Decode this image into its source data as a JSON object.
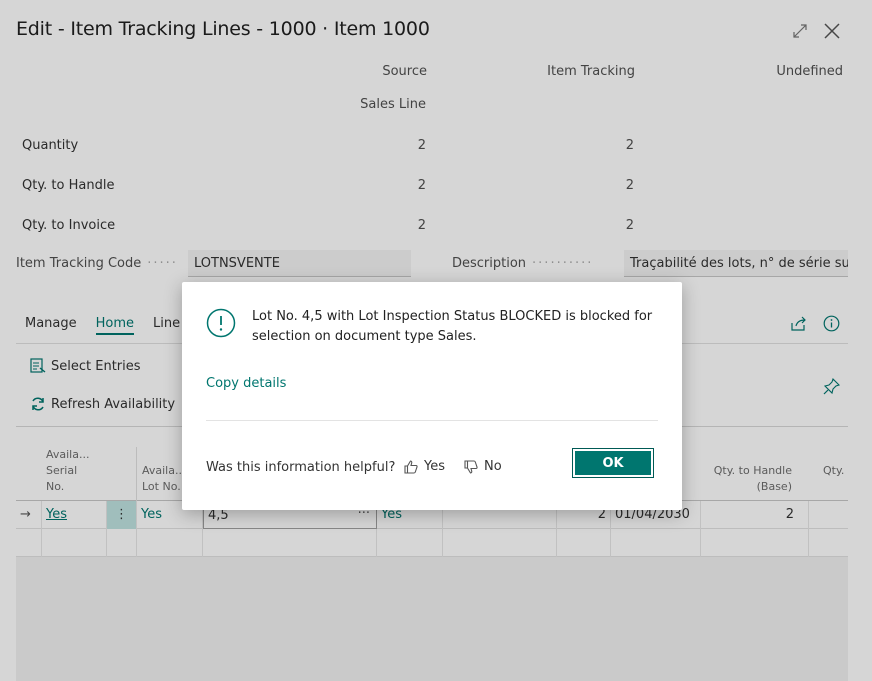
{
  "window": {
    "title": "Edit - Item Tracking Lines - 1000 · Item 1000"
  },
  "summary": {
    "col_source": "Source",
    "col_item_tracking": "Item Tracking",
    "col_undefined": "Undefined",
    "source_sub": "Sales Line",
    "rows": [
      {
        "label": "Quantity",
        "source": "2",
        "tracking": "2"
      },
      {
        "label": "Qty. to Handle",
        "source": "2",
        "tracking": "2"
      },
      {
        "label": "Qty. to Invoice",
        "source": "2",
        "tracking": "2"
      }
    ]
  },
  "fields": {
    "item_tracking_code_label": "Item Tracking Code",
    "item_tracking_code_value": "LOTNSVENTE",
    "description_label": "Description",
    "description_value": "Traçabilité des lots, n° de série su..."
  },
  "tabs": [
    "Manage",
    "Home",
    "Line"
  ],
  "actions": {
    "select_entries": "Select Entries",
    "refresh_availability": "Refresh Availability"
  },
  "grid": {
    "headers": {
      "avail_serial": [
        "Availa...",
        "Serial",
        "No."
      ],
      "avail_lot": [
        "Availa...",
        "Lot No."
      ],
      "qty_to_handle_base": [
        "Qty. to Handle",
        "(Base)"
      ],
      "qty": "Qty."
    },
    "row1": {
      "avail_serial": "Yes",
      "avail_lot": "Yes",
      "lot_no": "4,5",
      "col4": "Yes",
      "qty": "2",
      "date": "01/04/2030",
      "qty_handle": "2"
    }
  },
  "dialog": {
    "message": "Lot No. 4,5 with Lot Inspection Status BLOCKED is blocked for selection on document type Sales.",
    "copy_details": "Copy details",
    "helpful_question": "Was this information helpful?",
    "yes": "Yes",
    "no": "No",
    "ok": "OK"
  },
  "colors": {
    "accent": "#00766f"
  }
}
